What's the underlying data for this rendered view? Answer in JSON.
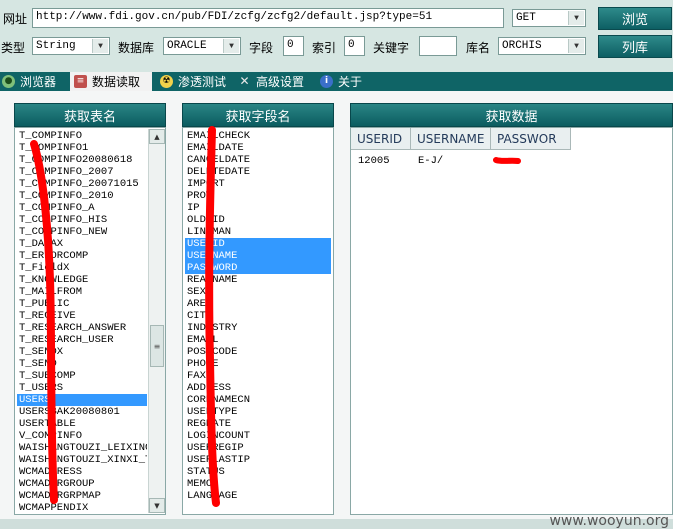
{
  "toolbar": {
    "url_label": "网址",
    "url_value": "http://www.fdi.gov.cn/pub/FDI/zcfg/zcfg2/default.jsp?type=51",
    "method_value": "GET",
    "browse_button": "浏览",
    "type_label": "类型",
    "type_value": "String",
    "db_label": "数据库",
    "db_value": "ORACLE",
    "field_label": "字段",
    "field_value": "0",
    "index_label": "索引",
    "index_value": "0",
    "keyword_label": "关键字",
    "keyword_value": "",
    "dbname_label": "库名",
    "dbname_value": "ORCHIS",
    "list_button": "列库"
  },
  "tabs": [
    {
      "label": "浏览器",
      "icon": "globe-icon"
    },
    {
      "label": "数据读取",
      "icon": "database-icon"
    },
    {
      "label": "渗透测试",
      "icon": "radiation-icon"
    },
    {
      "label": "高级设置",
      "icon": "tools-icon"
    },
    {
      "label": "关于",
      "icon": "info-icon"
    }
  ],
  "tables_panel": {
    "header": "获取表名",
    "items": [
      "T_COMPINFO",
      "T_COMPINFO1",
      "T_COMPINFO20080618",
      "T_COMPINFO_2007",
      "T_COMPINFO_20071015",
      "T_COMPINFO_2010",
      "T_COMPINFO_A",
      "T_COMPINFO_HIS",
      "T_COMPINFO_NEW",
      "T_DATAX",
      "T_ERRORCOMP",
      "T_FieldX",
      "T_KNOWLEDGE",
      "T_MAILFROM",
      "T_PUBLIC",
      "T_RECEIVE",
      "T_RESEARCH_ANSWER",
      "T_RESEARCH_USER",
      "T_SENDX",
      "T_SEND",
      "T_SUBCOMP",
      "T_USERS",
      "USERS",
      "USERSBAK20080801",
      "USERTABLE",
      "V_COMPINFO",
      "WAISHANGTOUZI_LEIXING_",
      "WAISHANGTOUZI_XINXI_T",
      "WCMADDRESS",
      "WCMADDRGROUP",
      "WCMADDRGRPMAP",
      "WCMAPPENDIX"
    ],
    "selected": "USERS"
  },
  "fields_panel": {
    "header": "获取字段名",
    "items": [
      "EMAILCHECK",
      "EMAILDATE",
      "CANCELDATE",
      "DELETEDATE",
      "IMPORT",
      "PROV",
      "IP",
      "OLD_ID",
      "LINKMAN",
      "USERID",
      "USERNAME",
      "PASSWORD",
      "REALNAME",
      "SEX",
      "AREA",
      "CITY",
      "INDUSTRY",
      "EMAIL",
      "POSTCODE",
      "PHONE",
      "FAX",
      "ADDRESS",
      "CORPNAMECN",
      "USERTYPE",
      "REGDATE",
      "LOGINCOUNT",
      "USERREGIP",
      "USERLASTIP",
      "STATUS",
      "MEMO",
      "LANGUAGE"
    ],
    "selected": [
      "USERID",
      "USERNAME",
      "PASSWORD"
    ]
  },
  "data_panel": {
    "header": "获取数据",
    "columns": [
      "USERID",
      "USERNAME",
      "PASSWOR"
    ],
    "rows": [
      [
        "12005",
        "E-J/",
        ""
      ]
    ]
  },
  "watermark": "www.wooyun.org",
  "colors": {
    "accent": "#0f6466",
    "selection": "#3399ff",
    "annotation": "#ff0000"
  }
}
